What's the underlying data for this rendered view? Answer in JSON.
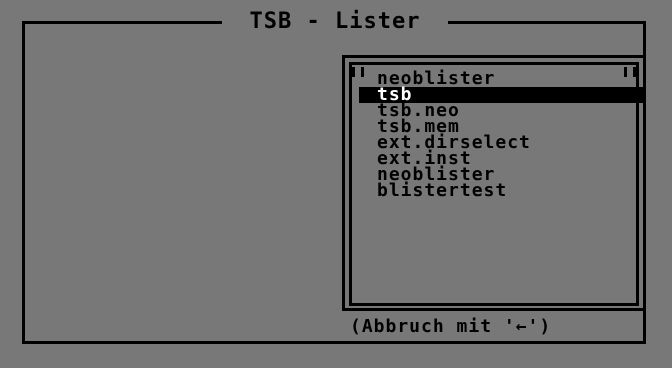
{
  "window": {
    "title": "TSB - Lister"
  },
  "list": {
    "items": [
      {
        "label": "neoblister"
      },
      {
        "label": "tsb"
      },
      {
        "label": "tsb.neo"
      },
      {
        "label": "tsb.mem"
      },
      {
        "label": "ext.dirselect"
      },
      {
        "label": "ext.inst"
      },
      {
        "label": "neoblister"
      },
      {
        "label": "blistertest"
      }
    ],
    "selected_item": "tsb"
  },
  "footer": {
    "hint": "(Abbruch mit '←')"
  }
}
